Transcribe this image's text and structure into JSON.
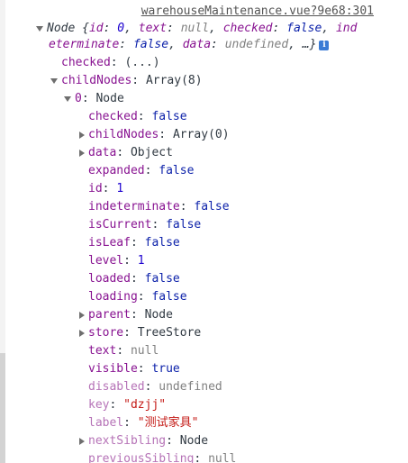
{
  "source_link": "warehouseMaintenance.vue?9e68:301",
  "summary": {
    "line1": "Node {id: 0, text: null, checked: false, ind",
    "line2": "eterminate: false, data: undefined, …}"
  },
  "info_badge": "i",
  "checked_label": "checked",
  "checked_value": "(...)",
  "childNodes": {
    "key": "childNodes",
    "value": "Array(8)"
  },
  "item0": {
    "key": "0",
    "value": "Node"
  },
  "props": [
    {
      "key": "checked",
      "value": "false"
    },
    {
      "key": "childNodes",
      "value": "Array(0)"
    },
    {
      "key": "data",
      "value": "Object"
    },
    {
      "key": "expanded",
      "value": "false"
    },
    {
      "key": "id",
      "value": "1"
    },
    {
      "key": "indeterminate",
      "value": "false"
    },
    {
      "key": "isCurrent",
      "value": "false"
    },
    {
      "key": "isLeaf",
      "value": "false"
    },
    {
      "key": "level",
      "value": "1"
    },
    {
      "key": "loaded",
      "value": "false"
    },
    {
      "key": "loading",
      "value": "false"
    },
    {
      "key": "parent",
      "value": "Node"
    },
    {
      "key": "store",
      "value": "TreeStore"
    },
    {
      "key": "text",
      "value": "null"
    },
    {
      "key": "visible",
      "value": "true"
    },
    {
      "key": "disabled",
      "value": "undefined"
    },
    {
      "key": "key",
      "value": "\"dzjj\""
    },
    {
      "key": "label",
      "value": "\"测试家具\""
    },
    {
      "key": "nextSibling",
      "value": "Node"
    },
    {
      "key": "previousSibling",
      "value": "null"
    }
  ],
  "colors": {
    "key": "#881391",
    "number": "#1c00cf",
    "boolean": "#0d22aa",
    "string": "#c41a16",
    "null": "#808080"
  },
  "icons": [
    "expand-arrow-icon",
    "collapse-arrow-icon",
    "info-icon"
  ]
}
